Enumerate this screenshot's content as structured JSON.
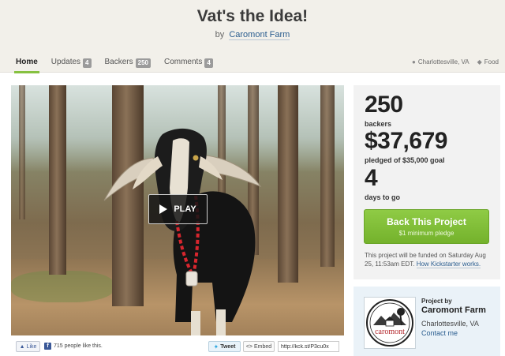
{
  "project": {
    "title": "Vat's the Idea!",
    "by_prefix": "by",
    "creator": "Caromont Farm"
  },
  "tabs": [
    {
      "label": "Home",
      "active": true
    },
    {
      "label": "Updates",
      "count": "4"
    },
    {
      "label": "Backers",
      "count": "250"
    },
    {
      "label": "Comments",
      "count": "4"
    }
  ],
  "meta": {
    "location": "Charlottesville, VA",
    "category": "Food",
    "location_icon": "map-pin-icon",
    "category_icon": "tag-icon"
  },
  "video": {
    "play_label": "PLAY"
  },
  "share": {
    "like_label": "Like",
    "likes_text": "715 people like this.",
    "tweet_label": "Tweet",
    "embed_label": "Embed",
    "short_url": "http://kck.st/P3cu0x"
  },
  "stats": {
    "backers_count": "250",
    "backers_label": "backers",
    "pledged_amount": "$37,679",
    "pledged_label": "pledged of $35,000 goal",
    "days_count": "4",
    "days_label": "days to go"
  },
  "cta": {
    "label": "Back This Project",
    "sublabel": "$1 minimum pledge"
  },
  "funding_note": {
    "text": "This project will be funded on Saturday Aug 25, 11:53am EDT.",
    "link": "How Kickstarter works."
  },
  "creator_card": {
    "heading": "Project by",
    "name": "Caromont Farm",
    "location": "Charlottesville, VA",
    "contact": "Contact me",
    "logo_text": "caromont"
  },
  "colors": {
    "accent_green": "#86c140",
    "link_blue": "#2a5d8f",
    "header_bg": "#f2f0ea",
    "stats_bg": "#f2f2f2",
    "creator_bg": "#eaf2f8"
  }
}
